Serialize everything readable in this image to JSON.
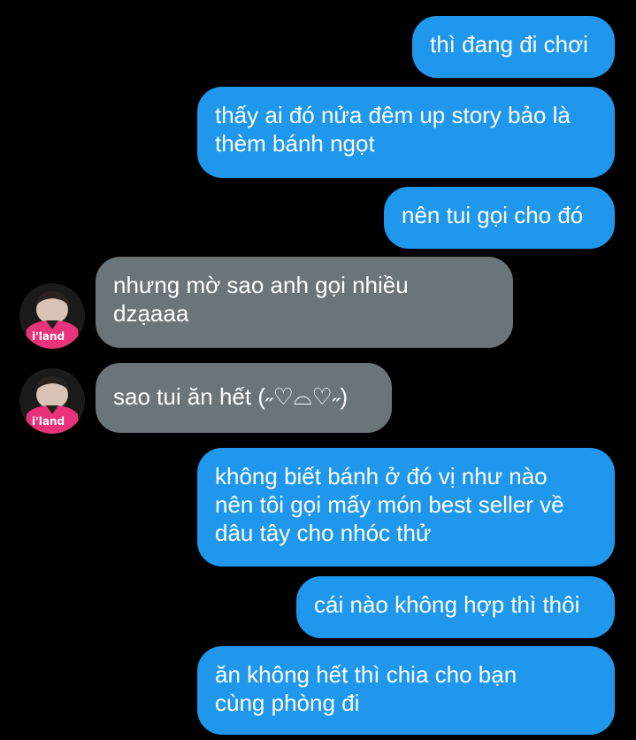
{
  "conversation": {
    "messages": [
      {
        "direction": "outgoing",
        "text": "thì đang đi chơi"
      },
      {
        "direction": "outgoing",
        "text": "thấy ai đó nửa đêm up story bảo là\nthèm bánh ngọt"
      },
      {
        "direction": "outgoing",
        "text": "nên tui gọi cho đó"
      },
      {
        "direction": "incoming",
        "text": "nhưng mờ sao anh gọi nhiều\ndzạaaa"
      },
      {
        "direction": "incoming",
        "text": "sao tui ăn hết (˶♡⌓♡˶)"
      },
      {
        "direction": "outgoing",
        "text": "không biết bánh ở đó vị như nào\nnên tôi gọi mấy món best seller về\ndâu tây cho nhóc thử"
      },
      {
        "direction": "outgoing",
        "text": "cái nào không hợp thì thôi"
      },
      {
        "direction": "outgoing",
        "text": "ăn không hết thì chia cho bạn\ncùng phòng đi"
      }
    ],
    "avatar": {
      "jersey_text": "i'land"
    }
  },
  "colors": {
    "background": "#000000",
    "outgoing_bubble": "#1e97ec",
    "incoming_bubble": "#6a7479",
    "text": "#ffffff",
    "jersey": "#e8337a"
  }
}
